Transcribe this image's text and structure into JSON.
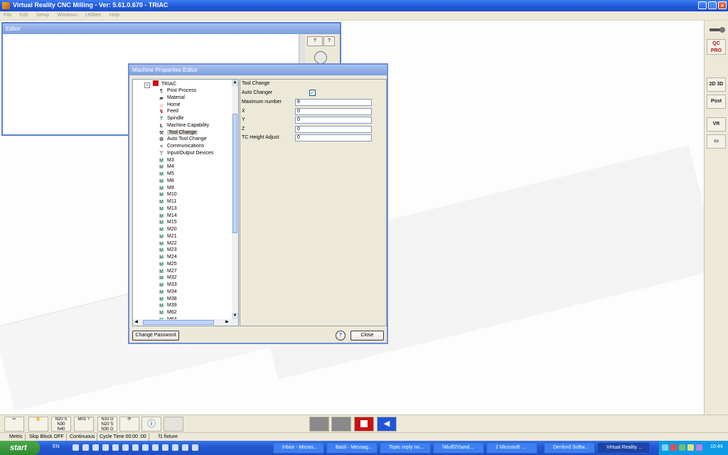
{
  "window": {
    "title": "Virtual Reality CNC Milling - Ver: 5.61.0.670 - TRIAC",
    "minimize": "_",
    "maximize": "□",
    "close": "✕"
  },
  "menu": [
    "File",
    "Edit",
    "Setup",
    "Windows",
    "Utilities",
    "Help"
  ],
  "editor": {
    "title": "Editor"
  },
  "dialog": {
    "title": "Machine Properties Editor",
    "tree": {
      "root": "TRIAC",
      "items": [
        {
          "label": "Post Process",
          "icon": "post-process-icon"
        },
        {
          "label": "Material",
          "icon": "material-icon"
        },
        {
          "label": "Home",
          "icon": "home-icon"
        },
        {
          "label": "Feed",
          "icon": "feed-icon"
        },
        {
          "label": "Spindle",
          "icon": "spindle-icon"
        },
        {
          "label": "Machine Capability",
          "icon": "machine-capability-icon"
        },
        {
          "label": "Tool Change",
          "icon": "tool-change-icon"
        },
        {
          "label": "Auto Tool Change",
          "icon": "auto-tool-change-icon"
        },
        {
          "label": "Communications",
          "icon": "communications-icon"
        },
        {
          "label": "Input/Output Devices",
          "icon": "io-devices-icon"
        },
        {
          "label": "M3",
          "icon": "m-code-icon"
        },
        {
          "label": "M4",
          "icon": "m-code-icon"
        },
        {
          "label": "M5",
          "icon": "m-code-icon"
        },
        {
          "label": "M8",
          "icon": "m-code-icon"
        },
        {
          "label": "M9",
          "icon": "m-code-icon"
        },
        {
          "label": "M10",
          "icon": "m-code-icon"
        },
        {
          "label": "M11",
          "icon": "m-code-icon"
        },
        {
          "label": "M13",
          "icon": "m-code-icon"
        },
        {
          "label": "M14",
          "icon": "m-code-icon"
        },
        {
          "label": "M15",
          "icon": "m-code-icon"
        },
        {
          "label": "M20",
          "icon": "m-code-icon"
        },
        {
          "label": "M21",
          "icon": "m-code-icon"
        },
        {
          "label": "M22",
          "icon": "m-code-icon"
        },
        {
          "label": "M23",
          "icon": "m-code-icon"
        },
        {
          "label": "M24",
          "icon": "m-code-icon"
        },
        {
          "label": "M25",
          "icon": "m-code-icon"
        },
        {
          "label": "M27",
          "icon": "m-code-icon"
        },
        {
          "label": "M32",
          "icon": "m-code-icon"
        },
        {
          "label": "M33",
          "icon": "m-code-icon"
        },
        {
          "label": "M34",
          "icon": "m-code-icon"
        },
        {
          "label": "M38",
          "icon": "m-code-icon"
        },
        {
          "label": "M39",
          "icon": "m-code-icon"
        },
        {
          "label": "M62",
          "icon": "m-code-icon"
        },
        {
          "label": "M64",
          "icon": "m-code-icon"
        }
      ],
      "selected": "Tool Change"
    },
    "properties": {
      "heading": "Tool Change",
      "auto_changer_label": "Auto Changer",
      "auto_changer_checked": true,
      "fields": [
        {
          "label": "Maximum number",
          "value": "8"
        },
        {
          "label": "X",
          "value": "0"
        },
        {
          "label": "Y",
          "value": "0"
        },
        {
          "label": "Z",
          "value": "0"
        },
        {
          "label": "TC Height Adjust",
          "value": "0"
        }
      ]
    },
    "change_password": "Change Password",
    "help": "?",
    "close": "Close"
  },
  "right_toolbar": [
    "QC PRO",
    "2D 3D",
    "Post",
    "VR"
  ],
  "bottom_toolbar": {
    "b1": "N20 S\nN30\nN40",
    "b2": "M01 ?",
    "b3": "N10 G\nN20 S\nN30 G"
  },
  "status": [
    "Metric",
    "Skip Block OFF",
    "Continuous",
    "Cycle Time 00:00 :00",
    "f1 fixture"
  ],
  "taskbar": {
    "start": "start",
    "lang": "EN",
    "tasks": [
      "Inbox - Micros...",
      "Basil - Messag...",
      "Topic reply no...",
      "\\\\Buff2\\Sand...",
      "2 Microsoft ...",
      "Denford Softw...",
      "Virtual Reality ..."
    ],
    "clock": "10:44"
  },
  "colors": {
    "title_blue": "#1f56d8",
    "stop_red": "#cc1010",
    "taskbar_blue": "#2458d0",
    "start_green": "#3a9a3a"
  }
}
